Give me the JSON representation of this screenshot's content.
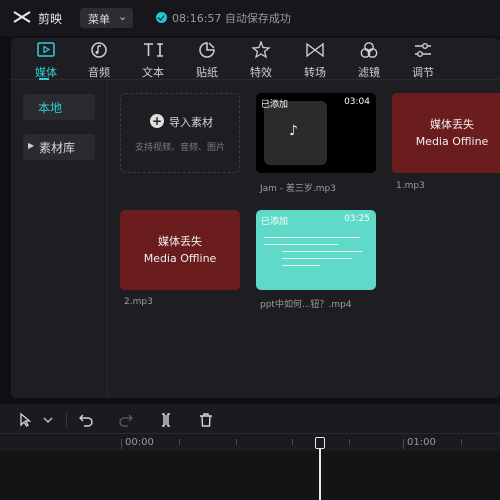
{
  "app": {
    "name": "剪映"
  },
  "header": {
    "menu_label": "菜单",
    "status_text": "08:16:57 自动保存成功"
  },
  "toolbar": {
    "tabs": [
      {
        "label": "媒体",
        "icon": "media-icon",
        "active": true
      },
      {
        "label": "音频",
        "icon": "audio-icon"
      },
      {
        "label": "文本",
        "icon": "text-icon"
      },
      {
        "label": "贴纸",
        "icon": "sticker-icon"
      },
      {
        "label": "特效",
        "icon": "effects-icon"
      },
      {
        "label": "转场",
        "icon": "transition-icon"
      },
      {
        "label": "滤镜",
        "icon": "filter-icon"
      },
      {
        "label": "调节",
        "icon": "adjust-icon"
      }
    ]
  },
  "sidebar": {
    "local": "本地",
    "library": "素材库"
  },
  "media": {
    "import": {
      "title": "导入素材",
      "hint": "支持视频、音频、图片"
    },
    "items": [
      {
        "badge": "已添加",
        "duration": "03:04",
        "name": "Jam - 差三岁.mp3",
        "type": "audio"
      },
      {
        "line1": "媒体丢失",
        "line2": "Media Offline",
        "name": "1.mp3",
        "type": "offline"
      },
      {
        "line1": "媒体丢失",
        "line2": "Media Offline",
        "name": "2.mp3",
        "type": "offline"
      },
      {
        "badge": "已添加",
        "duration": "03:25",
        "name": "ppt中如何...钮？.mp4",
        "type": "video"
      }
    ]
  },
  "timeline": {
    "ruler_start": "00:00",
    "ruler_mid": "01:00"
  },
  "colors": {
    "accent": "#2fd0d7",
    "offline": "#6b1c1c",
    "video_thumb": "#5fd9c8"
  }
}
